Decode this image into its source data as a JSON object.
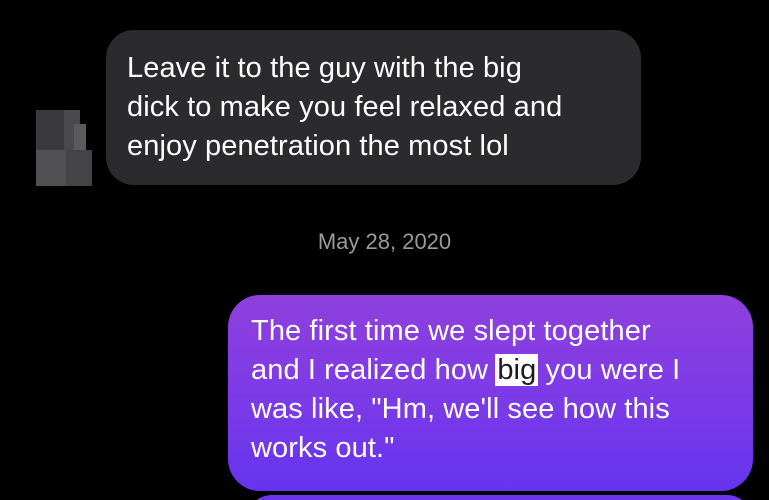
{
  "incoming_message": {
    "lines": [
      "Leave it to the guy with the big",
      "dick to make you feel relaxed and",
      "enjoy penetration the most lol"
    ]
  },
  "date_divider": "May 28, 2020",
  "outgoing_message": {
    "lines": [
      "The first time we slept together",
      "and I realized how ",
      "big",
      " you were I",
      "was like, \"Hm, we'll see how this",
      "works out.\""
    ],
    "highlighted_word": "big"
  },
  "colors": {
    "background": "#000000",
    "incoming_bubble": "#2b2b2d",
    "outgoing_bubble_top": "#8f3fdc",
    "outgoing_bubble_bottom": "#6534ee",
    "date_text": "#9a9a9a",
    "highlight": "#ffffff"
  },
  "icons": {
    "sender_avatar": "pixelated-avatar-icon"
  }
}
